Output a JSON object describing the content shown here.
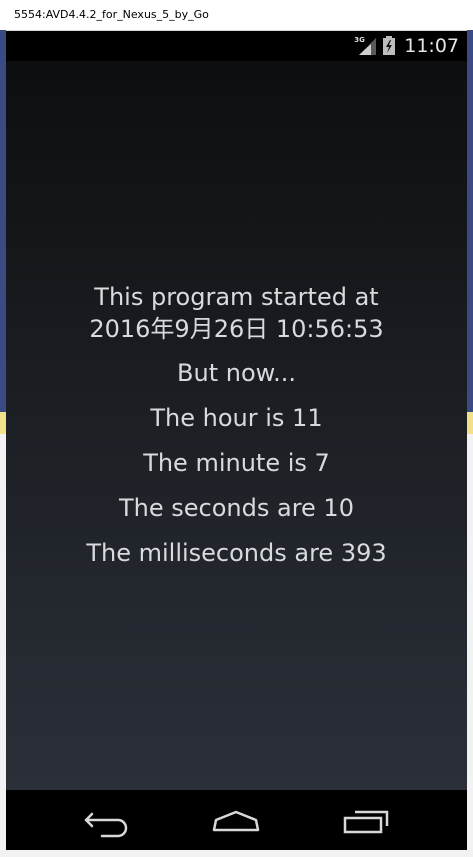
{
  "window": {
    "title": "5554:AVD4.4.2_for_Nexus_5_by_Go"
  },
  "status_bar": {
    "network_type": "3G",
    "icons": [
      "signal-icon",
      "battery-icon"
    ],
    "time": "11:07"
  },
  "content": {
    "started_line1": "This program started at",
    "started_line2": "2016年9月26日 10:56:53",
    "but_now": "But now...",
    "hour": "The hour is 11",
    "minute": "The minute is 7",
    "seconds": "The seconds are 10",
    "milliseconds": "The milliseconds are 393"
  },
  "nav_bar": {
    "icons": [
      "back-icon",
      "home-icon",
      "recent-apps-icon"
    ]
  },
  "colors": {
    "screen_top": "#0b0c0d",
    "screen_bottom": "#2b2f38",
    "text": "#d8dadd",
    "bars": "#000000"
  }
}
